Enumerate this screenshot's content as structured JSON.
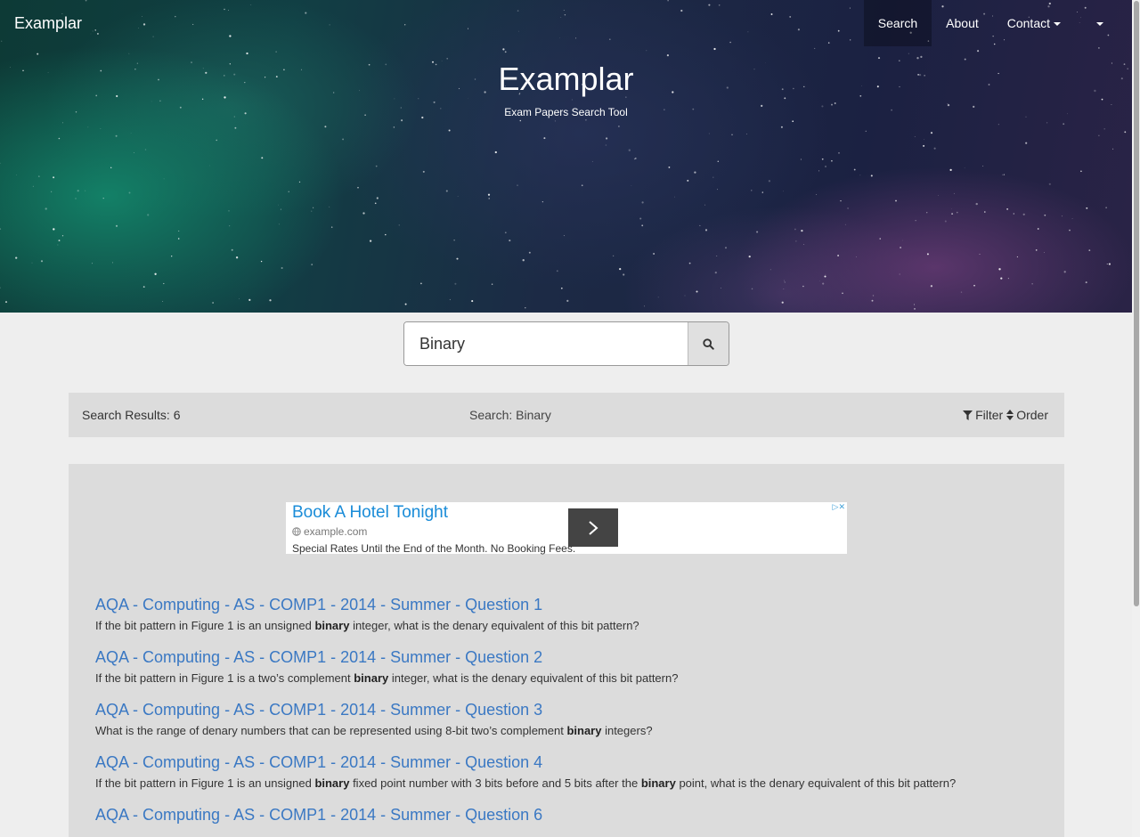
{
  "navbar": {
    "brand": "Examplar",
    "items": [
      {
        "label": "Search"
      },
      {
        "label": "About"
      },
      {
        "label": "Contact"
      }
    ]
  },
  "hero": {
    "title": "Examplar",
    "subtitle": "Exam Papers Search Tool"
  },
  "search": {
    "value": "Binary",
    "button_icon": "search-icon"
  },
  "results_bar": {
    "count_text": "Search Results: 6",
    "query_text": "Search: Binary",
    "filter_label": "Filter",
    "order_label": "Order"
  },
  "ad": {
    "title": "Book A Hotel Tonight",
    "domain": "example.com",
    "text": "Special Rates Until the End of the Month. No Booking Fees."
  },
  "results": [
    {
      "title": "AQA - Computing - AS - COMP1 - 2014 - Summer - Question 1",
      "snippet": [
        "If the bit pattern in Figure 1 is an unsigned ",
        "binary",
        " integer, what is the denary equivalent of this bit pattern?"
      ]
    },
    {
      "title": "AQA - Computing - AS - COMP1 - 2014 - Summer - Question 2",
      "snippet": [
        "If the bit pattern in Figure 1 is a two’s complement ",
        "binary",
        " integer, what is the denary equivalent of this bit pattern?"
      ]
    },
    {
      "title": "AQA - Computing - AS - COMP1 - 2014 - Summer - Question 3",
      "snippet": [
        "What is the range of denary numbers that can be represented using 8-bit two’s complement ",
        "binary",
        " integers?"
      ]
    },
    {
      "title": "AQA - Computing - AS - COMP1 - 2014 - Summer - Question 4",
      "snippet": [
        "If the bit pattern in Figure 1 is an unsigned ",
        "binary",
        " fixed point number with 3 bits before and 5 bits after the ",
        "binary",
        " point, what is the denary equivalent of this bit pattern?"
      ]
    },
    {
      "title": "AQA - Computing - AS - COMP1 - 2014 - Summer - Question 6",
      "snippet": [
        ""
      ]
    }
  ]
}
